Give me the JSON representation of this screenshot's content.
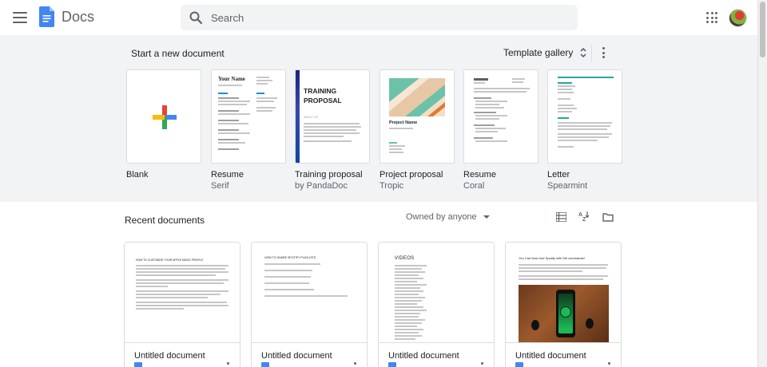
{
  "header": {
    "app_name": "Docs",
    "search_placeholder": "Search",
    "menu_icon": "hamburger-menu-icon",
    "apps_icon": "google-apps-grid-icon"
  },
  "templates": {
    "section_title": "Start a new document",
    "gallery_label": "Template gallery",
    "items": [
      {
        "name": "Blank",
        "sub": ""
      },
      {
        "name": "Resume",
        "sub": "Serif",
        "preview_title": "Your Name"
      },
      {
        "name": "Training proposal",
        "sub": "by PandaDoc",
        "preview_title": "TRAINING PROPOSAL",
        "preview_sub": "ABOUT US"
      },
      {
        "name": "Project proposal",
        "sub": "Tropic",
        "preview_title": "Project Name"
      },
      {
        "name": "Resume",
        "sub": "Coral"
      },
      {
        "name": "Letter",
        "sub": "Spearmint"
      }
    ]
  },
  "recent": {
    "section_title": "Recent documents",
    "owner_filter": "Owned by anyone",
    "docs": [
      {
        "title": "Untitled document",
        "preview_heading": "HOW TO CUSTOMIZE YOUR APPLE MUSIC PROFILE"
      },
      {
        "title": "Untitled document",
        "preview_heading": "HOW TO SHARE SPOTIFY PLAYLISTS"
      },
      {
        "title": "Untitled document",
        "preview_heading": "VIDEOS"
      },
      {
        "title": "Untitled document",
        "preview_heading": "You Can Now Use Spotify with Siri commands!"
      }
    ]
  },
  "colors": {
    "band_background": "#f1f3f4",
    "docs_blue": "#4285f4",
    "spotify_green": "#1db954",
    "tropic_teal": "#6cc2a8"
  }
}
